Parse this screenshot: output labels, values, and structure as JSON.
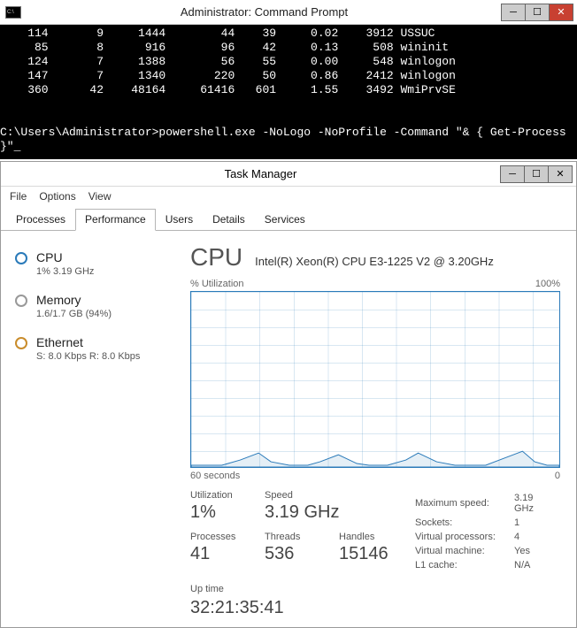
{
  "cmd": {
    "title": "Administrator: Command Prompt",
    "rows": [
      {
        "a": "114",
        "b": "9",
        "c": "1444",
        "d": "44",
        "e": "39",
        "f": "0.02",
        "g": "3912",
        "h": "USSUC"
      },
      {
        "a": "85",
        "b": "8",
        "c": "916",
        "d": "96",
        "e": "42",
        "f": "0.13",
        "g": "508",
        "h": "wininit"
      },
      {
        "a": "124",
        "b": "7",
        "c": "1388",
        "d": "56",
        "e": "55",
        "f": "0.00",
        "g": "548",
        "h": "winlogon"
      },
      {
        "a": "147",
        "b": "7",
        "c": "1340",
        "d": "220",
        "e": "50",
        "f": "0.86",
        "g": "2412",
        "h": "winlogon"
      },
      {
        "a": "360",
        "b": "42",
        "c": "48164",
        "d": "61416",
        "e": "601",
        "f": "1.55",
        "g": "3492",
        "h": "WmiPrvSE"
      }
    ],
    "prompt": "C:\\Users\\Administrator>powershell.exe -NoLogo -NoProfile -Command \"& { Get-Process }\"_"
  },
  "tm": {
    "title": "Task Manager",
    "menu": {
      "file": "File",
      "options": "Options",
      "view": "View"
    },
    "tabs": {
      "processes": "Processes",
      "performance": "Performance",
      "users": "Users",
      "details": "Details",
      "services": "Services"
    },
    "side": {
      "cpu": {
        "name": "CPU",
        "sub": "1%  3.19 GHz"
      },
      "mem": {
        "name": "Memory",
        "sub": "1.6/1.7 GB (94%)"
      },
      "eth": {
        "name": "Ethernet",
        "sub": "S: 8.0 Kbps R: 8.0 Kbps"
      }
    },
    "main": {
      "heading": "CPU",
      "model": "Intel(R) Xeon(R) CPU E3-1225 V2 @ 3.20GHz",
      "axis_top_left": "% Utilization",
      "axis_top_right": "100%",
      "axis_bot_left": "60 seconds",
      "axis_bot_right": "0",
      "util_lbl": "Utilization",
      "util_val": "1%",
      "speed_lbl": "Speed",
      "speed_val": "3.19 GHz",
      "proc_lbl": "Processes",
      "proc_val": "41",
      "thr_lbl": "Threads",
      "thr_val": "536",
      "hnd_lbl": "Handles",
      "hnd_val": "15146",
      "kv": {
        "maxspeed_k": "Maximum speed:",
        "maxspeed_v": "3.19 GHz",
        "sockets_k": "Sockets:",
        "sockets_v": "1",
        "vproc_k": "Virtual processors:",
        "vproc_v": "4",
        "vm_k": "Virtual machine:",
        "vm_v": "Yes",
        "l1_k": "L1 cache:",
        "l1_v": "N/A"
      },
      "uptime_lbl": "Up time",
      "uptime_val": "32:21:35:41"
    }
  },
  "chart_data": {
    "type": "line",
    "title": "% Utilization",
    "xlabel": "seconds",
    "ylabel": "% Utilization",
    "xlim": [
      60,
      0
    ],
    "ylim": [
      0,
      100
    ],
    "x": [
      60,
      57,
      55,
      52,
      49,
      47,
      44,
      41,
      39,
      36,
      33,
      31,
      28,
      25,
      23,
      20,
      17,
      15,
      12,
      9,
      6,
      4,
      2,
      0
    ],
    "values": [
      1,
      1,
      1,
      4,
      8,
      3,
      1,
      1,
      3,
      7,
      2,
      1,
      1,
      4,
      8,
      3,
      1,
      1,
      1,
      5,
      9,
      3,
      1,
      1
    ]
  }
}
